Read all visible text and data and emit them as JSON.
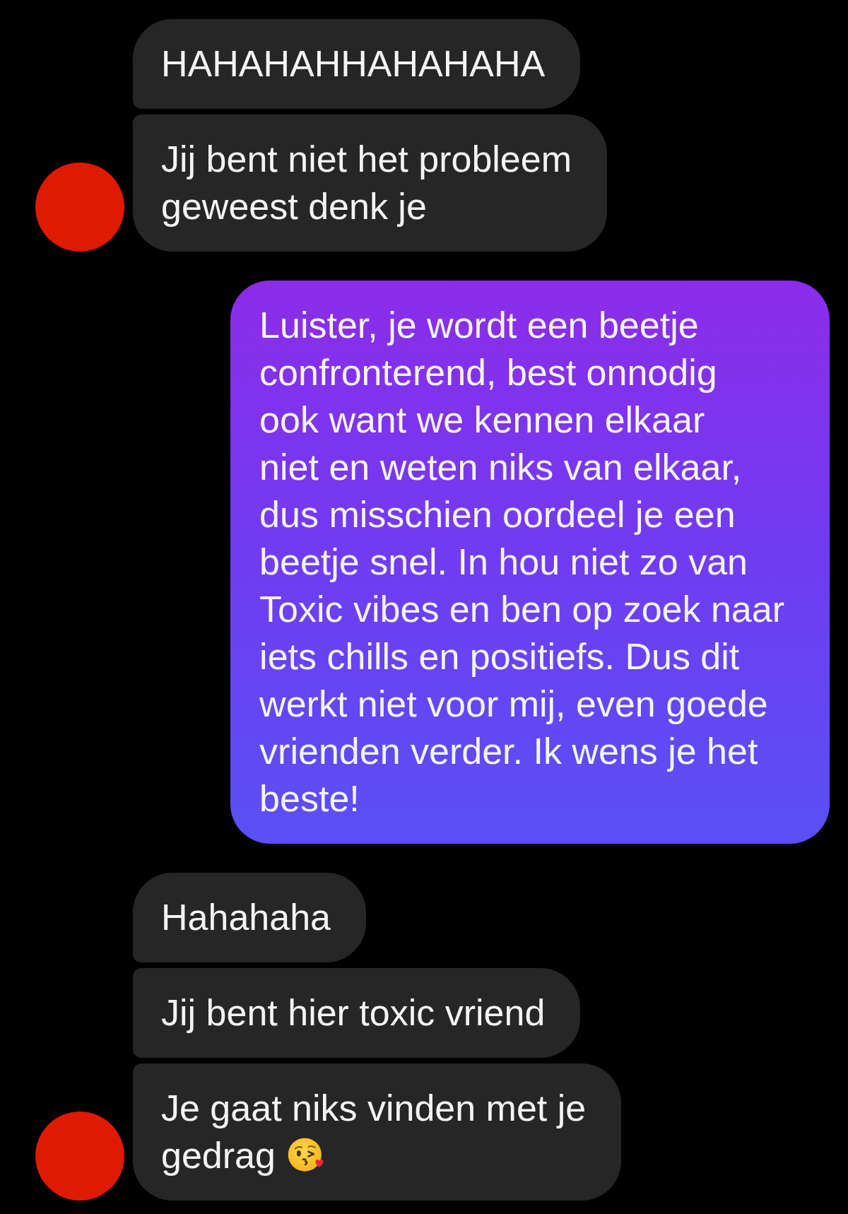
{
  "messages": [
    {
      "kind": "received",
      "avatar": false,
      "text": "HAHAHAHHAHAHAHA"
    },
    {
      "kind": "received",
      "avatar": true,
      "text": "Jij bent niet het probleem\ngeweest denk je"
    },
    {
      "kind": "sent",
      "text": "Luister, je wordt een beetje\nconfronterend, best onnodig\nook want we kennen elkaar\nniet en weten niks van elkaar,\ndus misschien oordeel je een\nbeetje snel. In hou niet zo van\nToxic vibes en ben op zoek naar\niets chills en positiefs. Dus dit\nwerkt niet voor mij, even goede\nvrienden verder. Ik wens je het\nbeste!"
    },
    {
      "kind": "received",
      "avatar": false,
      "text": "Hahahaha"
    },
    {
      "kind": "received",
      "avatar": false,
      "text": "Jij bent hier toxic vriend"
    },
    {
      "kind": "received",
      "avatar": true,
      "emoji": true,
      "text": "Je gaat niks vinden met je\ngedrag"
    }
  ]
}
